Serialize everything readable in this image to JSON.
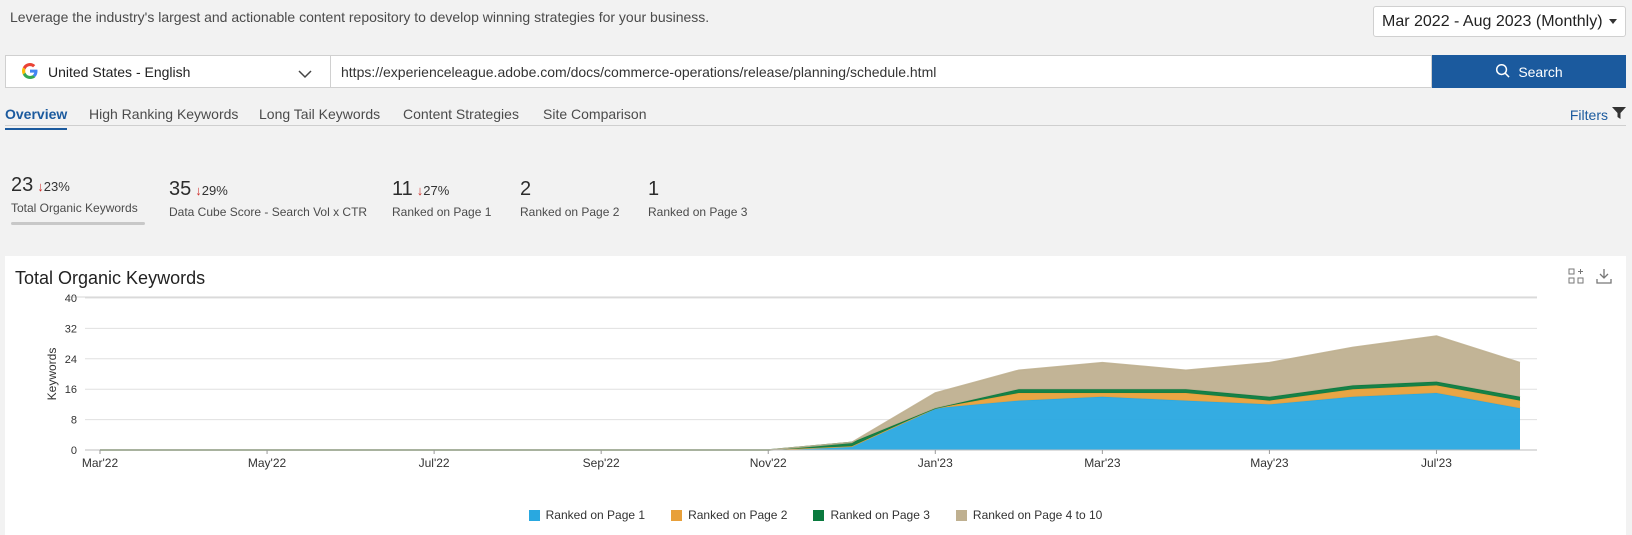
{
  "header": {
    "tagline": "Leverage the industry's largest and actionable content repository to develop winning strategies for your business.",
    "date_range": "Mar 2022 - Aug 2023 (Monthly)"
  },
  "search": {
    "locale": "United States - English",
    "url": "https://experienceleague.adobe.com/docs/commerce-operations/release/planning/schedule.html",
    "button": "Search"
  },
  "tabs": [
    {
      "label": "Overview"
    },
    {
      "label": "High Ranking Keywords"
    },
    {
      "label": "Long Tail Keywords"
    },
    {
      "label": "Content Strategies"
    },
    {
      "label": "Site Comparison"
    }
  ],
  "filters_label": "Filters",
  "stats": [
    {
      "value": "23",
      "delta": "23%",
      "label": "Total Organic Keywords"
    },
    {
      "value": "35",
      "delta": "29%",
      "label": "Data Cube Score - Search Vol x CTR"
    },
    {
      "value": "11",
      "delta": "27%",
      "label": "Ranked on Page 1"
    },
    {
      "value": "2",
      "delta": "",
      "label": "Ranked on Page 2"
    },
    {
      "value": "1",
      "delta": "",
      "label": "Ranked on Page 3"
    }
  ],
  "card": {
    "title": "Total Organic Keywords"
  },
  "chart_data": {
    "type": "area",
    "stacked": true,
    "ylabel": "Keywords",
    "ylim": [
      0,
      40
    ],
    "yticks": [
      0,
      8,
      16,
      24,
      32,
      40
    ],
    "x": [
      "Mar'22",
      "Apr'22",
      "May'22",
      "Jun'22",
      "Jul'22",
      "Aug'22",
      "Sep'22",
      "Oct'22",
      "Nov'22",
      "Dec'22",
      "Jan'23",
      "Feb'23",
      "Mar'23",
      "Apr'23",
      "May'23",
      "Jun'23",
      "Jul'23",
      "Aug'23"
    ],
    "xticks": [
      "Mar'22",
      "May'22",
      "Jul'22",
      "Sep'22",
      "Nov'22",
      "Jan'23",
      "Mar'23",
      "May'23",
      "Jul'23"
    ],
    "grid": true,
    "legend_position": "bottom",
    "series": [
      {
        "name": "Ranked on Page 1",
        "color": "#29a8e0",
        "values": [
          0,
          0,
          0,
          0,
          0,
          0,
          0,
          0,
          0,
          1,
          11,
          13,
          14,
          13,
          12,
          14,
          15,
          11
        ]
      },
      {
        "name": "Ranked on Page 2",
        "color": "#e8a03a",
        "values": [
          0,
          0,
          0,
          0,
          0,
          0,
          0,
          0,
          0,
          0,
          0,
          2,
          1,
          2,
          1,
          2,
          2,
          2
        ]
      },
      {
        "name": "Ranked on Page 3",
        "color": "#0a7a3e",
        "values": [
          0,
          0,
          0,
          0,
          0,
          0,
          0,
          0,
          0,
          1,
          0,
          1,
          1,
          1,
          1,
          1,
          1,
          1
        ]
      },
      {
        "name": "Ranked on Page 4 to 10",
        "color": "#bfb090",
        "values": [
          0,
          0,
          0,
          0,
          0,
          0,
          0,
          0,
          0,
          0,
          4,
          5,
          7,
          5,
          9,
          10,
          12,
          9
        ]
      }
    ]
  }
}
